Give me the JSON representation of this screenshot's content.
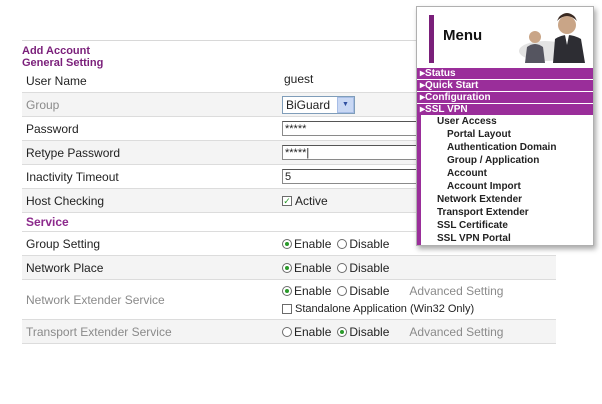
{
  "form": {
    "title_line1": "Add Account",
    "title_line2": "General Setting",
    "rows": {
      "user_name": {
        "label": "User Name",
        "value": "guest"
      },
      "group": {
        "label": "Group",
        "value": "BiGuard"
      },
      "password": {
        "label": "Password",
        "value": "*****"
      },
      "retype_password": {
        "label": "Retype Password",
        "value": "*****|"
      },
      "inactivity_timeout": {
        "label": "Inactivity Timeout",
        "value": "5"
      },
      "host_checking": {
        "label": "Host Checking",
        "option": "Active"
      }
    },
    "service_heading": "Service",
    "services": {
      "group_setting": {
        "label": "Group Setting",
        "enable": "Enable",
        "disable": "Disable"
      },
      "network_place": {
        "label": "Network Place",
        "enable": "Enable",
        "disable": "Disable"
      },
      "network_extender": {
        "label": "Network Extender Service",
        "enable": "Enable",
        "disable": "Disable",
        "advanced": "Advanced Setting",
        "standalone": "Standalone Application (Win32 Only)"
      },
      "transport_extender": {
        "label": "Transport Extender Service",
        "enable": "Enable",
        "disable": "Disable",
        "advanced": "Advanced Setting"
      }
    }
  },
  "menu": {
    "title": "Menu",
    "top_items": [
      "Status",
      "Quick Start",
      "Configuration",
      "SSL VPN"
    ],
    "user_access": "User Access",
    "user_access_items": [
      "Portal Layout",
      "Authentication Domain",
      "Group / Application",
      "Account",
      "Account Import"
    ],
    "other_items": [
      "Network Extender",
      "Transport Extender",
      "SSL Certificate",
      "SSL VPN Portal"
    ]
  },
  "colors": {
    "accent": "#9a2e9a",
    "title": "#7a1f7a"
  }
}
